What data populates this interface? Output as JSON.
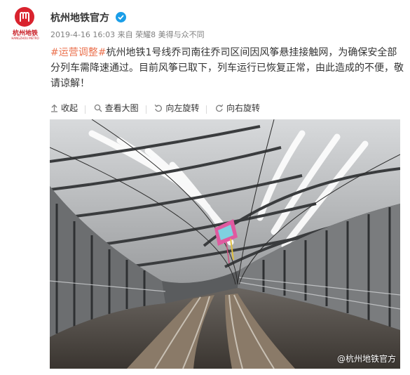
{
  "account": {
    "name": "杭州地铁官方",
    "logo_text": "杭州地铁",
    "logo_subtext": "HANGZHOU METRO",
    "verified_color": "#1a9ee8",
    "brand_color": "#d9232e"
  },
  "post": {
    "date": "2019-4-16 16:03",
    "source_prefix": "来自",
    "source": "荣耀8 美得与众不同",
    "hashtag": "#运营调整#",
    "text": "杭州地铁1号线乔司南往乔司区间因风筝悬挂接触网，为确保安全部分列车需降速通过。目前风筝已取下，列车运行已恢复正常，由此造成的不便，敬请谅解！",
    "hashtag_color": "#eb7350"
  },
  "toolbar": {
    "collapse": "收起",
    "view_large": "查看大图",
    "rotate_left": "向左旋转",
    "rotate_right": "向右旋转"
  },
  "photo": {
    "watermark": "@杭州地铁官方"
  }
}
